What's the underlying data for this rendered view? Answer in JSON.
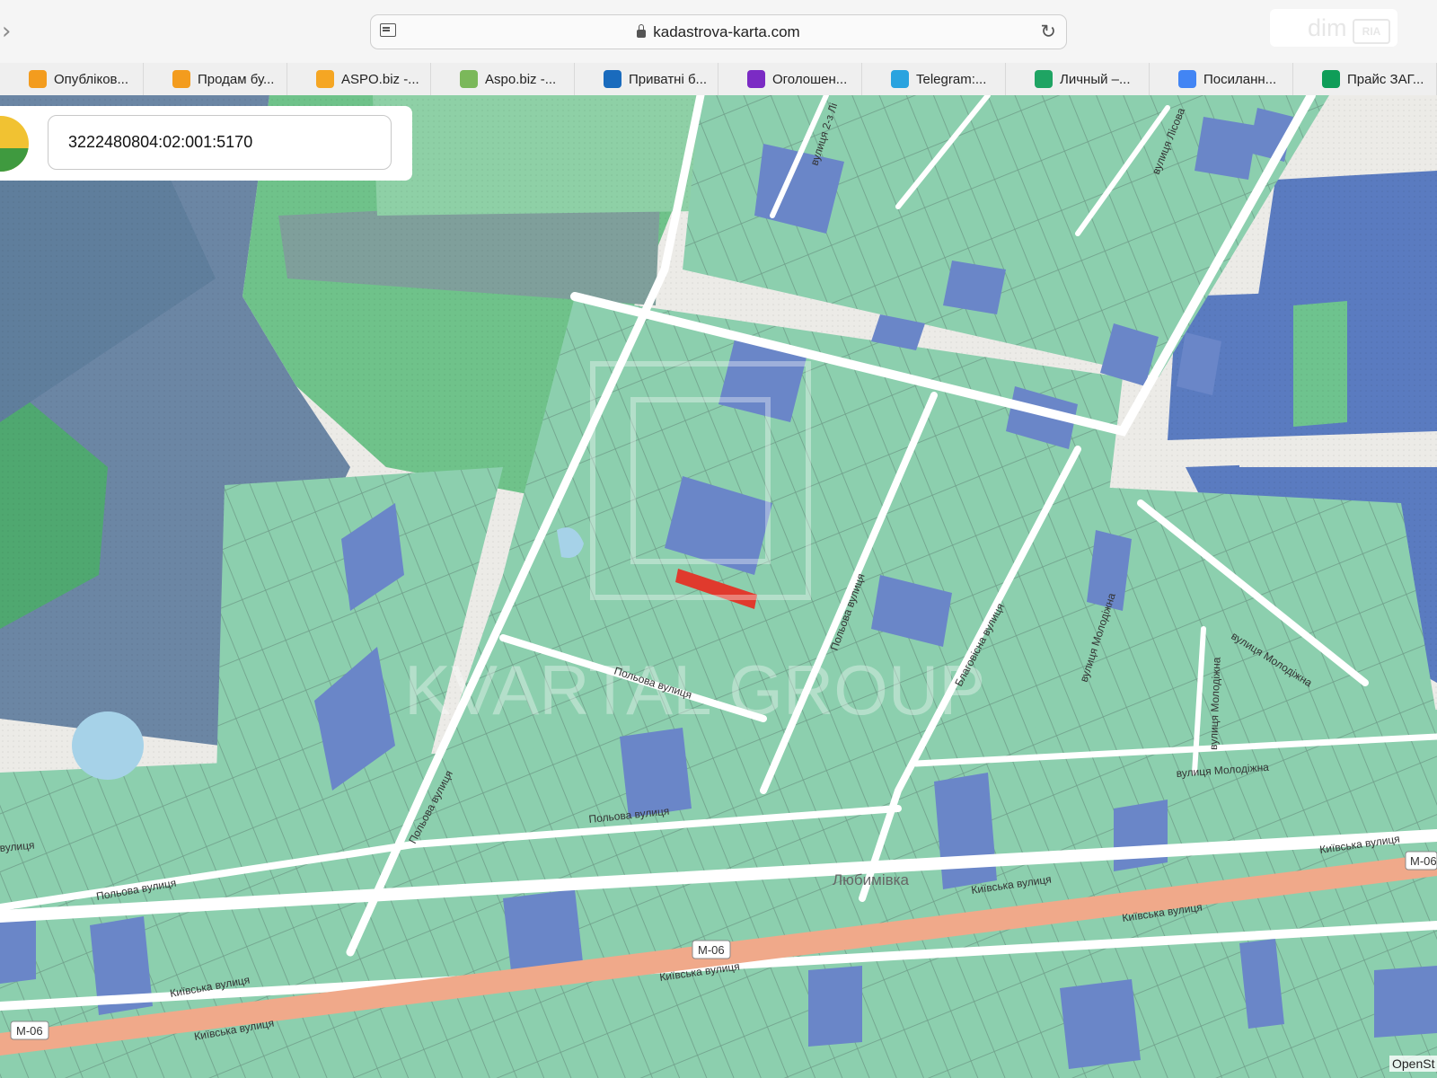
{
  "browser": {
    "url": "kadastrova-karta.com",
    "dim_badge": {
      "main": "dim",
      "sub": "RIA"
    }
  },
  "bookmarks": [
    {
      "label": "Опубліков...",
      "icon": "orange-checkbox-icon",
      "color": "#f39c1e"
    },
    {
      "label": "Продам бу...",
      "icon": "orange-checkbox-icon",
      "color": "#f39c1e"
    },
    {
      "label": "ASPO.biz -...",
      "icon": "aspo-logo-icon",
      "color": "#f5a623"
    },
    {
      "label": "Aspo.biz -...",
      "icon": "envelope-icon",
      "color": "#7bb85a"
    },
    {
      "label": "Приватні б...",
      "icon": "olx-logo-icon",
      "color": "#1a6bbd"
    },
    {
      "label": "Оголошен...",
      "icon": "purple-pin-icon",
      "color": "#7b2bc4"
    },
    {
      "label": "Telegram:...",
      "icon": "telegram-icon",
      "color": "#2aa3df"
    },
    {
      "label": "Личный –...",
      "icon": "google-drive-icon",
      "color": "#1fa463"
    },
    {
      "label": "Посиланн...",
      "icon": "google-docs-icon",
      "color": "#4285f4"
    },
    {
      "label": "Прайс ЗАГ...",
      "icon": "google-sheets-icon",
      "color": "#0f9d58"
    }
  ],
  "search": {
    "value": "3222480804:02:001:5170",
    "logo_icon": "app-logo-icon"
  },
  "map": {
    "watermark": "KVARTAL GROUP",
    "village": "Любимівка",
    "attribution": "OpenSt",
    "highlight_color": "#e03a2d",
    "street_labels": [
      {
        "text": "вулиця 2-з Лі"
      },
      {
        "text": "вулиця Лісова"
      },
      {
        "text": "Польова вулиця"
      },
      {
        "text": "Польова вулиця"
      },
      {
        "text": "Польова вулиця"
      },
      {
        "text": "Польова вулиця"
      },
      {
        "text": "Польова вулиця"
      },
      {
        "text": "вулиця"
      },
      {
        "text": "Благовісна вулиця"
      },
      {
        "text": "вулиця Молодіжна"
      },
      {
        "text": "вулиця Молодіжна"
      },
      {
        "text": "вулиця Молодіжна"
      },
      {
        "text": "вулиця Молодіжна"
      },
      {
        "text": "Київська вулиця"
      },
      {
        "text": "Київська вулиця"
      },
      {
        "text": "Київська вулиця"
      },
      {
        "text": "Київська вулиця"
      },
      {
        "text": "Київська вулиця"
      },
      {
        "text": "Київська вулиця"
      },
      {
        "text": "M-06"
      },
      {
        "text": "M-06"
      },
      {
        "text": "M-06"
      }
    ]
  }
}
